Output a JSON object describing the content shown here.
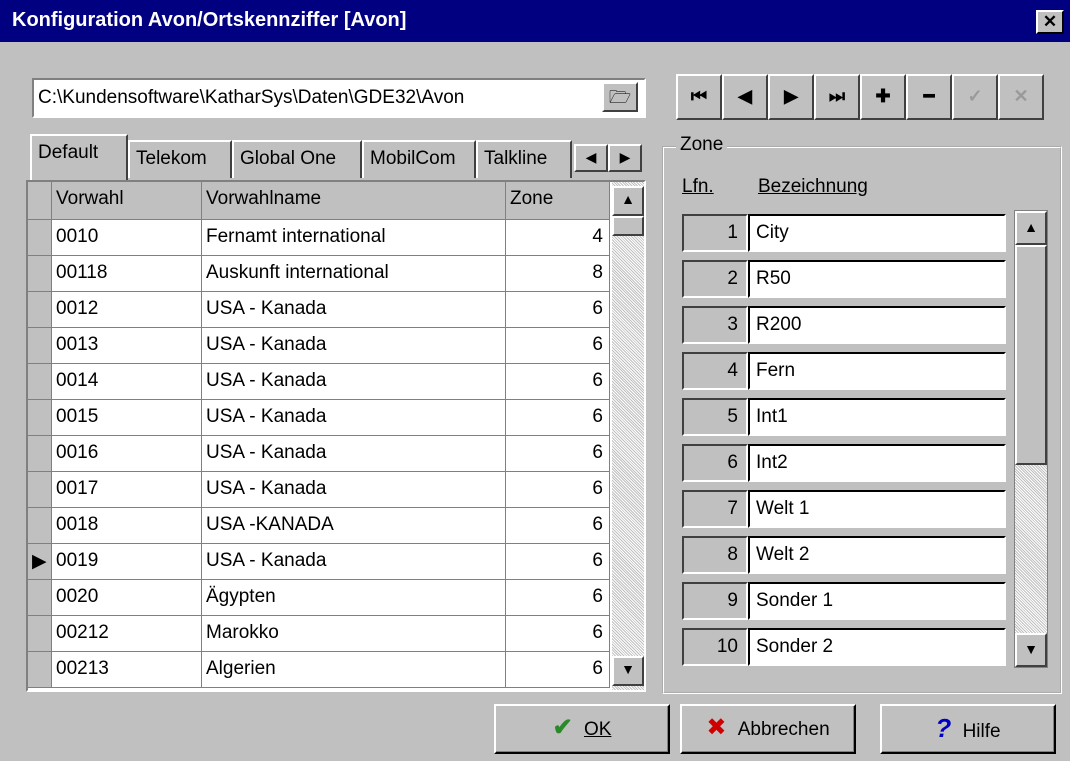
{
  "window": {
    "title": "Konfiguration Avon/Ortskennziffer  [Avon]",
    "close_glyph": "✕"
  },
  "path": {
    "value": "C:\\Kundensoftware\\KatharSys\\Daten\\GDE32\\Avon",
    "browse_glyph": "🗁"
  },
  "nav": {
    "first": "⏮",
    "prev": "◀",
    "next": "▶",
    "last": "⏭",
    "add": "✚",
    "remove": "━",
    "confirm": "✓",
    "cancel": "✕"
  },
  "tabs": [
    "Default",
    "Telekom",
    "Global One",
    "MobilCom",
    "Talkline"
  ],
  "tab_scroll": {
    "left": "◀",
    "right": "▶"
  },
  "grid": {
    "columns": [
      "Vorwahl",
      "Vorwahlname",
      "Zone"
    ],
    "current_indicator": "▶",
    "rows": [
      [
        "0010",
        "Fernamt international",
        "4"
      ],
      [
        "00118",
        "Auskunft international",
        "8"
      ],
      [
        "0012",
        "USA - Kanada",
        "6"
      ],
      [
        "0013",
        "USA - Kanada",
        "6"
      ],
      [
        "0014",
        "USA - Kanada",
        "6"
      ],
      [
        "0015",
        "USA - Kanada",
        "6"
      ],
      [
        "0016",
        "USA - Kanada",
        "6"
      ],
      [
        "0017",
        "USA - Kanada",
        "6"
      ],
      [
        "0018",
        "USA -KANADA",
        "6"
      ],
      [
        "0019",
        "USA - Kanada",
        "6"
      ],
      [
        "0020",
        "Ägypten",
        "6"
      ],
      [
        "00212",
        "Marokko",
        "6"
      ],
      [
        "00213",
        "Algerien",
        "6"
      ]
    ],
    "scroll_up": "▲",
    "scroll_down": "▼"
  },
  "zone": {
    "legend": "Zone",
    "header_lfn": "Lfn.",
    "header_name": "Bezeichnung",
    "items": [
      [
        "1",
        "City"
      ],
      [
        "2",
        "R50"
      ],
      [
        "3",
        "R200"
      ],
      [
        "4",
        "Fern"
      ],
      [
        "5",
        "Int1"
      ],
      [
        "6",
        "Int2"
      ],
      [
        "7",
        "Welt 1"
      ],
      [
        "8",
        "Welt 2"
      ],
      [
        "9",
        "Sonder 1"
      ],
      [
        "10",
        "Sonder 2"
      ]
    ],
    "scroll_up": "▲",
    "scroll_down": "▼"
  },
  "buttons": {
    "ok": "OK",
    "ok_icon": "✔",
    "cancel": "Abbrechen",
    "cancel_icon": "✖",
    "help": "Hilfe",
    "help_icon": "?"
  },
  "colors": {
    "titlebar": "#000080",
    "face": "#c0c0c0",
    "ok_icon": "#2a8a2a",
    "cancel_icon": "#d00000",
    "help_icon": "#0000c0"
  }
}
